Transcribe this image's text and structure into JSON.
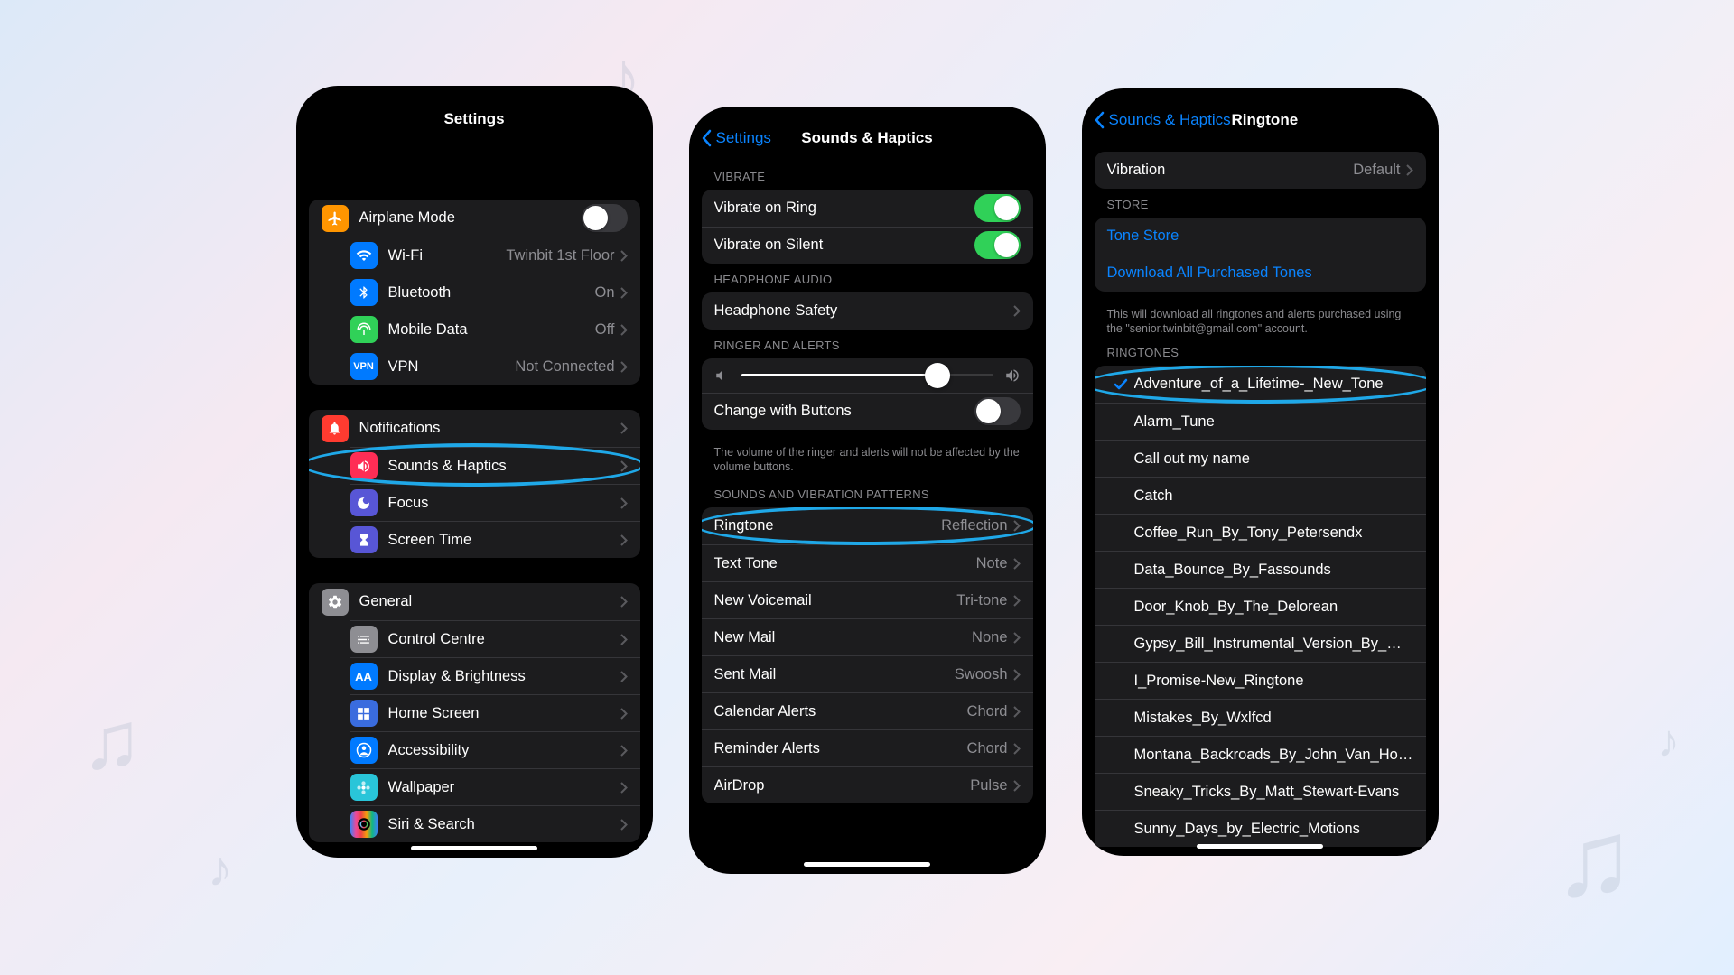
{
  "phone1": {
    "title": "Settings",
    "group1": [
      {
        "icon": "airplane",
        "bg": "#ff9500",
        "label": "Airplane Mode",
        "type": "toggle",
        "on": false
      },
      {
        "icon": "wifi",
        "bg": "#007aff",
        "label": "Wi-Fi",
        "type": "link",
        "value": "Twinbit 1st Floor"
      },
      {
        "icon": "bluetooth",
        "bg": "#007aff",
        "label": "Bluetooth",
        "type": "link",
        "value": "On"
      },
      {
        "icon": "antenna",
        "bg": "#30d158",
        "label": "Mobile Data",
        "type": "link",
        "value": "Off"
      },
      {
        "icon": "vpn",
        "bg": "#007aff",
        "label": "VPN",
        "type": "link",
        "value": "Not Connected"
      }
    ],
    "group2": [
      {
        "icon": "bell",
        "bg": "#ff3b30",
        "label": "Notifications",
        "type": "link"
      },
      {
        "icon": "speaker",
        "bg": "#ff2d55",
        "label": "Sounds & Haptics",
        "type": "link",
        "highlight": true
      },
      {
        "icon": "moon",
        "bg": "#5856d6",
        "label": "Focus",
        "type": "link"
      },
      {
        "icon": "hourglass",
        "bg": "#5856d6",
        "label": "Screen Time",
        "type": "link"
      }
    ],
    "group3": [
      {
        "icon": "gear",
        "bg": "#8e8e93",
        "label": "General",
        "type": "link"
      },
      {
        "icon": "switches",
        "bg": "#8e8e93",
        "label": "Control Centre",
        "type": "link"
      },
      {
        "icon": "aa",
        "bg": "#007aff",
        "label": "Display & Brightness",
        "type": "link"
      },
      {
        "icon": "grid",
        "bg": "#3a6cde",
        "label": "Home Screen",
        "type": "link"
      },
      {
        "icon": "person",
        "bg": "#007aff",
        "label": "Accessibility",
        "type": "link"
      },
      {
        "icon": "flower",
        "bg": "#29c5d9",
        "label": "Wallpaper",
        "type": "link"
      },
      {
        "icon": "siri",
        "bg": "gradient",
        "label": "Siri & Search",
        "type": "link"
      }
    ]
  },
  "phone2": {
    "back": "Settings",
    "title": "Sounds & Haptics",
    "section_vibrate": "VIBRATE",
    "vibrate_rows": [
      {
        "label": "Vibrate on Ring",
        "on": true
      },
      {
        "label": "Vibrate on Silent",
        "on": true
      }
    ],
    "section_headphone": "HEADPHONE AUDIO",
    "headphone_row": {
      "label": "Headphone Safety"
    },
    "section_ringer": "RINGER AND ALERTS",
    "slider_value": 78,
    "change_buttons": {
      "label": "Change with Buttons",
      "on": false
    },
    "ringer_footer": "The volume of the ringer and alerts will not be affected by the volume buttons.",
    "section_patterns": "SOUNDS AND VIBRATION PATTERNS",
    "pattern_rows": [
      {
        "label": "Ringtone",
        "value": "Reflection",
        "highlight": true
      },
      {
        "label": "Text Tone",
        "value": "Note"
      },
      {
        "label": "New Voicemail",
        "value": "Tri-tone"
      },
      {
        "label": "New Mail",
        "value": "None"
      },
      {
        "label": "Sent Mail",
        "value": "Swoosh"
      },
      {
        "label": "Calendar Alerts",
        "value": "Chord"
      },
      {
        "label": "Reminder Alerts",
        "value": "Chord"
      },
      {
        "label": "AirDrop",
        "value": "Pulse"
      }
    ]
  },
  "phone3": {
    "back": "Sounds & Haptics",
    "title": "Ringtone",
    "vibration": {
      "label": "Vibration",
      "value": "Default"
    },
    "section_store": "STORE",
    "store_links": [
      "Tone Store",
      "Download All Purchased Tones"
    ],
    "store_footer": "This will download all ringtones and alerts purchased using the \"senior.twinbit@gmail.com\" account.",
    "section_ringtones": "RINGTONES",
    "ringtones": [
      {
        "label": "Adventure_of_a_Lifetime-_New_Tone",
        "selected": true,
        "highlight": true
      },
      {
        "label": "Alarm_Tune"
      },
      {
        "label": "Call out my name"
      },
      {
        "label": "Catch"
      },
      {
        "label": "Coffee_Run_By_Tony_Petersendx"
      },
      {
        "label": "Data_Bounce_By_Fassounds"
      },
      {
        "label": "Door_Knob_By_The_Delorean"
      },
      {
        "label": "Gypsy_Bill_Instrumental_Version_By_Ofer_Lor…"
      },
      {
        "label": "I_Promise-New_Ringtone"
      },
      {
        "label": "Mistakes_By_Wxlfcd"
      },
      {
        "label": "Montana_Backroads_By_John_Van_Houdt"
      },
      {
        "label": "Sneaky_Tricks_By_Matt_Stewart-Evans"
      },
      {
        "label": "Sunny_Days_by_Electric_Motions"
      }
    ]
  }
}
